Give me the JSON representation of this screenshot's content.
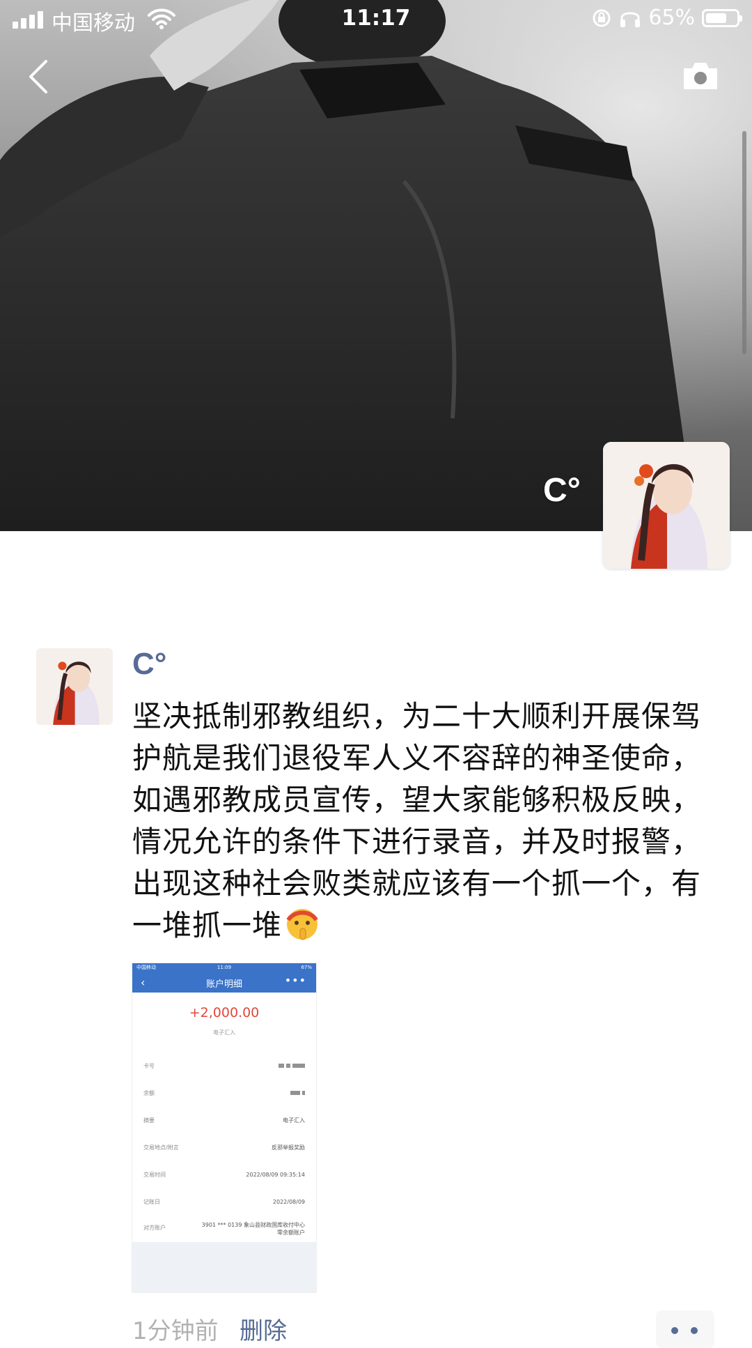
{
  "status_bar": {
    "carrier": "中国移动",
    "time": "11:17",
    "battery": "65%"
  },
  "cover": {
    "name": "C°",
    "icons": [
      "back-arrow-icon",
      "camera-icon"
    ]
  },
  "post": {
    "author": "C°",
    "text": "坚决抵制邪教组织，为二十大顺利开展保驾护航是我们退役军人义不容辞的神圣使命，如遇邪教成员宣传，望大家能够积极反映，情况允许的条件下进行录音，并及时报警，出现这种社会败类就应该有一个抓一个，有一堆抓一堆",
    "emoji": "shushing-face-emoji",
    "time": "1分钟前",
    "delete_label": "删除"
  },
  "attachment": {
    "status_left": "中国移动",
    "status_time": "11:09",
    "status_right": "67%",
    "title": "账户明细",
    "amount": "+2,000.00",
    "amount_sub": "电子汇入",
    "rows": [
      {
        "key": "卡号",
        "value": ""
      },
      {
        "key": "余额",
        "value": ""
      },
      {
        "key": "摘要",
        "value": "电子汇入"
      },
      {
        "key": "交易地点/附言",
        "value": "反邪举报奖励"
      },
      {
        "key": "交易时间",
        "value": "2022/08/09 09:35:14"
      },
      {
        "key": "记账日",
        "value": "2022/08/09"
      },
      {
        "key": "对方账户",
        "value": "3901 *** 0139 象山县财政国库收付中心"
      },
      {
        "key": "",
        "value": "零余额账户"
      }
    ]
  },
  "colors": {
    "link_blue": "#576b95",
    "bank_blue": "#3a73c8",
    "amount_red": "#e0483c",
    "time_gray": "#b2b2b2"
  }
}
